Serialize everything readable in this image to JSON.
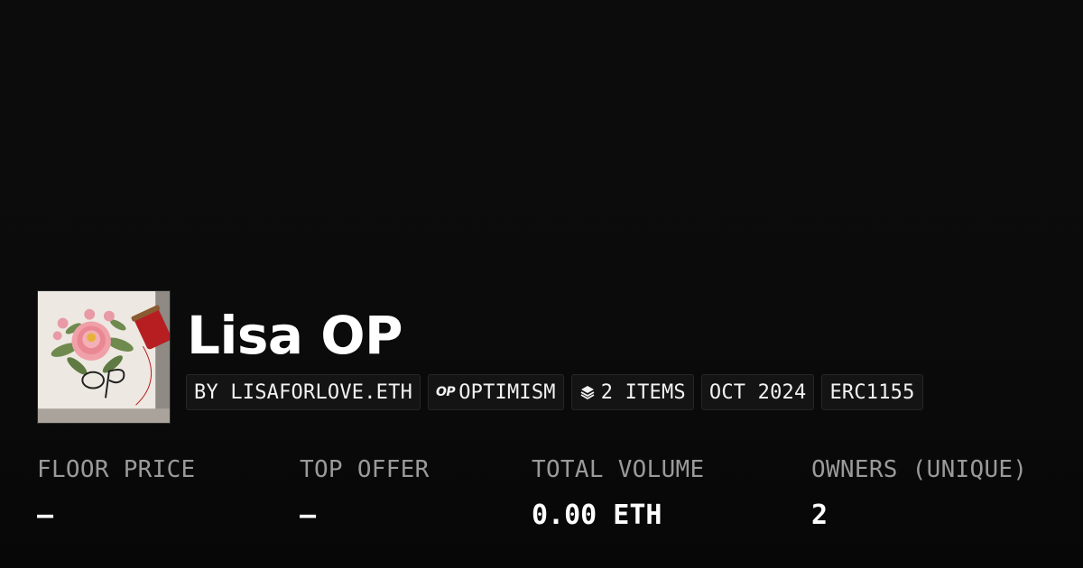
{
  "collection": {
    "name": "Lisa OP",
    "avatar_icon": "embroidered-rose-op-image"
  },
  "chips": [
    {
      "label": "BY LISAFORLOVE.ETH"
    },
    {
      "label": "OPTIMISM",
      "icon": "optimism-logo",
      "icon_text": "OP"
    },
    {
      "label": "2 ITEMS",
      "icon": "layers-icon"
    },
    {
      "label": "OCT 2024"
    },
    {
      "label": "ERC1155"
    }
  ],
  "stats": [
    {
      "label": "FLOOR PRICE",
      "value": "–"
    },
    {
      "label": "TOP OFFER",
      "value": "–"
    },
    {
      "label": "TOTAL VOLUME",
      "value": "0.00 ETH"
    },
    {
      "label": "OWNERS (UNIQUE)",
      "value": "2"
    }
  ],
  "colors": {
    "background": "#0b0b0b",
    "chip_background": "#141414",
    "chip_border": "#262626",
    "label": "#9a9a9a",
    "text": "#ffffff"
  }
}
